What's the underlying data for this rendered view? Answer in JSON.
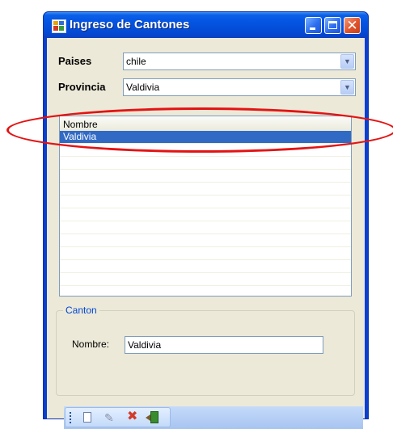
{
  "window": {
    "title": "Ingreso de Cantones",
    "icon": "app-window-icon",
    "controls": {
      "minimize": "minimize-icon",
      "maximize": "maximize-icon",
      "close": "close-icon",
      "close_glyph": "✕"
    }
  },
  "form": {
    "paises": {
      "label": "Paises",
      "value": "chile"
    },
    "provincia": {
      "label": "Provincia",
      "value": "Valdivia"
    },
    "dropdown_glyph": "▼"
  },
  "list": {
    "column_header": "Nombre",
    "rows": [
      "Valdivia"
    ],
    "selected_index": 0,
    "empty_rows": 13
  },
  "canton": {
    "legend": "Canton",
    "nombre_label": "Nombre:",
    "nombre_value": "Valdivia"
  },
  "toolbar": {
    "tools": [
      {
        "name": "new-icon"
      },
      {
        "name": "edit-pencil-icon",
        "glyph": "✎"
      },
      {
        "name": "delete-icon",
        "glyph": "✖"
      },
      {
        "name": "exit-icon"
      }
    ]
  },
  "colors": {
    "selection": "#316ac5",
    "annotation": "#e41313",
    "titlebar": "#0454e1",
    "group_legend": "#0046d5"
  }
}
